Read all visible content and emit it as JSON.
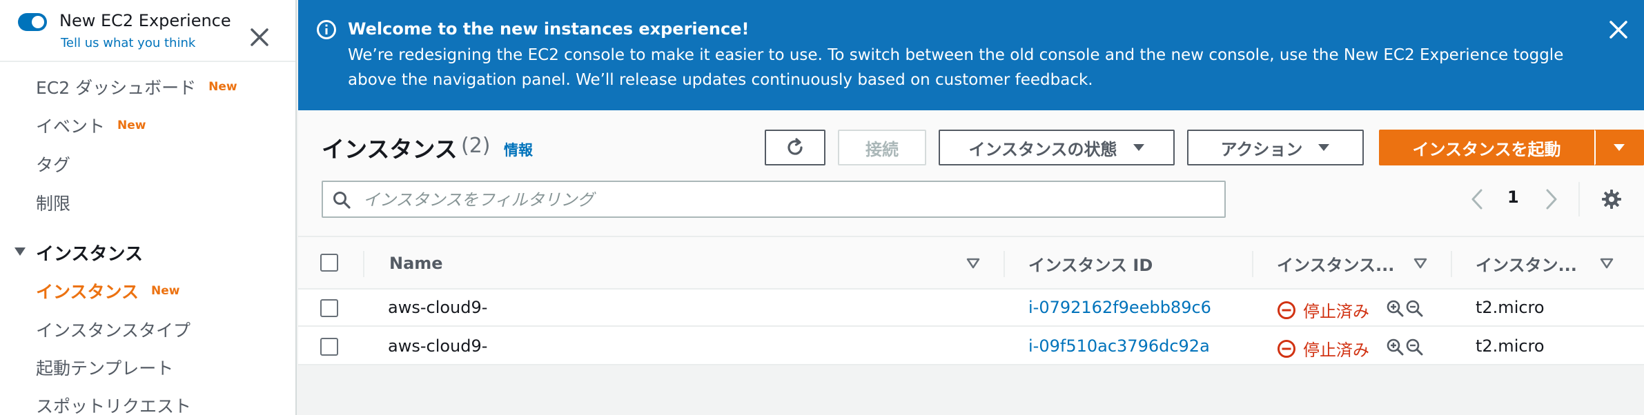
{
  "sidebar": {
    "toggle_title": "New EC2 Experience",
    "toggle_link": "Tell us what you think",
    "items": [
      {
        "label": "EC2 ダッシュボード",
        "badge": "New"
      },
      {
        "label": "イベント",
        "badge": "New"
      },
      {
        "label": "タグ",
        "badge": ""
      },
      {
        "label": "制限",
        "badge": ""
      }
    ],
    "section_title": "インスタンス",
    "section_items": [
      {
        "label": "インスタンス",
        "badge": "New"
      },
      {
        "label": "インスタンスタイプ",
        "badge": ""
      },
      {
        "label": "起動テンプレート",
        "badge": ""
      },
      {
        "label": "スポットリクエスト",
        "badge": ""
      }
    ]
  },
  "banner": {
    "title": "Welcome to the new instances experience!",
    "body": "We’re redesigning the EC2 console to make it easier to use. To switch between the old console and the new console, use the New EC2 Experience toggle above the navigation panel. We’ll release updates continuously based on customer feedback."
  },
  "main": {
    "title": "インスタンス",
    "count": "(2)",
    "info_link": "情報",
    "buttons": {
      "connect": "接続",
      "instance_state": "インスタンスの状態",
      "actions": "アクション",
      "launch": "インスタンスを起動"
    },
    "search": {
      "placeholder": "インスタンスをフィルタリング",
      "value": ""
    },
    "pagination": {
      "current_page": "1"
    }
  },
  "table": {
    "columns": [
      "Name",
      "インスタンス ID",
      "インスタンス...",
      "インスタン..."
    ],
    "rows": [
      {
        "name": "aws-cloud9-",
        "id": "i-0792162f9eebb89c6",
        "state": "停止済み",
        "type": "t2.micro"
      },
      {
        "name": "aws-cloud9-",
        "id": "i-09f510ac3796dc92a",
        "state": "停止済み",
        "type": "t2.micro"
      }
    ]
  },
  "colors": {
    "accent": "#ec7211",
    "link": "#0073bb",
    "banner": "#0f73ba",
    "stopped": "#d13212"
  },
  "icons": [
    "info-icon",
    "close-icon",
    "refresh-icon",
    "caret-down-icon",
    "search-icon",
    "chevron-left-icon",
    "chevron-right-icon",
    "gear-icon",
    "sort-icon",
    "stop-icon",
    "zoom-in-icon",
    "zoom-out-icon"
  ]
}
